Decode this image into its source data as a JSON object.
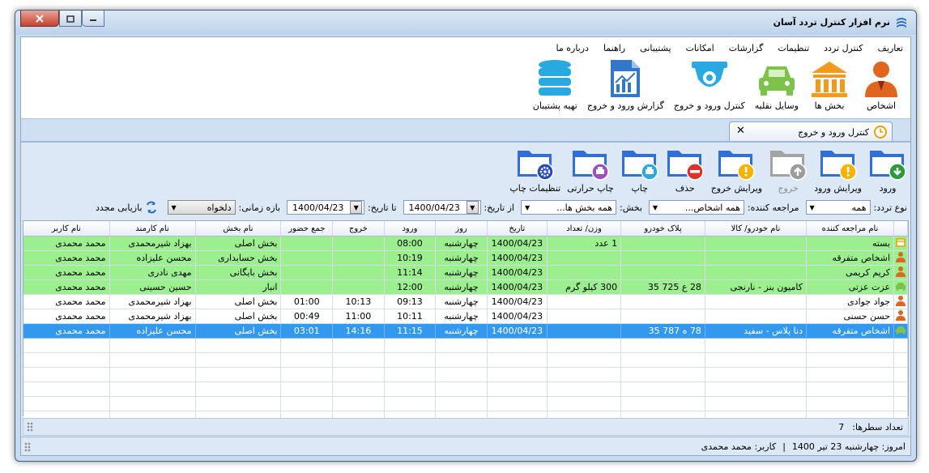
{
  "window": {
    "title": "نرم افزار کنترل تردد آسان"
  },
  "menu": [
    "تعاریف",
    "کنترل تردد",
    "تنظیمات",
    "گزارشات",
    "امکانات",
    "پشتیبانی",
    "راهنما",
    "درباره ما"
  ],
  "ribbon": [
    {
      "label": "اشخاص",
      "icon": "person-icon",
      "color": "#e0651f"
    },
    {
      "label": "بخش ها",
      "icon": "building-icon",
      "color": "#f39a1e"
    },
    {
      "label": "وسایل نقلیه",
      "icon": "car-icon",
      "color": "#7dc24a"
    },
    {
      "label": "کنترل ورود و خروج",
      "icon": "camera-icon",
      "color": "#2aa9e0"
    },
    {
      "label": "گزارش ورود و خروج",
      "icon": "report-icon",
      "color": "#3277c8"
    },
    {
      "label": "تهیه پشتیبان",
      "icon": "database-icon",
      "color": "#2aa9e0"
    }
  ],
  "tab": {
    "label": "کنترل ورود و خروج"
  },
  "toolbar": [
    {
      "label": "ورود",
      "badge": "arrow-down-icon",
      "badge_color": "#2e9b3b",
      "enabled": true
    },
    {
      "label": "ویرایش ورود",
      "badge": "warning-icon",
      "badge_color": "#f2b400",
      "enabled": true
    },
    {
      "label": "خروج",
      "badge": "arrow-up-icon",
      "badge_color": "#9c9c9c",
      "enabled": false
    },
    {
      "label": "ویرایش خروج",
      "badge": "warning-icon",
      "badge_color": "#f2b400",
      "enabled": true
    },
    {
      "label": "حذف",
      "badge": "minus-icon",
      "badge_color": "#d8342c",
      "enabled": true
    },
    {
      "label": "چاپ",
      "badge": "printer-icon",
      "badge_color": "#2aa9e0",
      "enabled": true
    },
    {
      "label": "چاپ حرارتی",
      "badge": "printer-icon",
      "badge_color": "#9b4fc3",
      "enabled": true
    },
    {
      "label": "تنظیمات چاپ",
      "badge": "gear-icon",
      "badge_color": "#2a49b8",
      "enabled": true
    }
  ],
  "filters": {
    "traffic_type_label": "نوع تردد:",
    "traffic_type_value": "همه",
    "visitor_label": "مراجعه کننده:",
    "visitor_value": "همه اشخاص...",
    "section_label": "بخش:",
    "section_value": "همه بخش ها...",
    "from_label": "از تاریخ:",
    "from_value": "1400/04/23",
    "to_label": "تا تاریخ:",
    "to_value": "1400/04/23",
    "range_label": "بازه زمانی:",
    "range_value": "دلخواه",
    "reload_label": "بازیابی مجدد"
  },
  "table": {
    "columns": [
      "نام مراجعه کننده",
      "نام خودرو/ کالا",
      "پلاک خودرو",
      "وزن/ تعداد",
      "تاریخ",
      "روز",
      "ورود",
      "خروج",
      "جمع حضور",
      "نام بخش",
      "نام کارمند",
      "نام کاربر"
    ],
    "rows": [
      {
        "icon": "package-icon",
        "style": "green",
        "cells": [
          "بسته",
          "",
          "",
          "1 عدد",
          "1400/04/23",
          "چهارشنبه",
          "08:00",
          "",
          "",
          "بخش اصلی",
          "بهزاد شیرمحمدی",
          "محمد محمدی"
        ]
      },
      {
        "icon": "person-icon",
        "style": "green",
        "cells": [
          "اشخاص متفرقه",
          "",
          "",
          "",
          "1400/04/23",
          "چهارشنبه",
          "10:19",
          "",
          "",
          "بخش حسابداری",
          "محسن علیزاده",
          "محمد محمدی"
        ]
      },
      {
        "icon": "person-icon",
        "style": "green",
        "cells": [
          "کریم کریمی",
          "",
          "",
          "",
          "1400/04/23",
          "چهارشنبه",
          "11:14",
          "",
          "",
          "بخش بایگانی",
          "مهدی نادری",
          "محمد محمدی"
        ]
      },
      {
        "icon": "car-icon",
        "style": "green",
        "cells": [
          "عزت عزتی",
          "کامیون بنز - نارنجی",
          "28 ع 725 35",
          "300 کیلو گرم",
          "1400/04/23",
          "چهارشنبه",
          "12:00",
          "",
          "",
          "انبار",
          "حسین حسینی",
          "محمد محمدی"
        ]
      },
      {
        "icon": "person-icon",
        "style": "white",
        "cells": [
          "جواد جوادی",
          "",
          "",
          "",
          "1400/04/23",
          "چهارشنبه",
          "09:13",
          "10:13",
          "01:00",
          "بخش اصلی",
          "بهزاد شیرمحمدی",
          "محمد محمدی"
        ]
      },
      {
        "icon": "person-icon",
        "style": "white",
        "cells": [
          "حسن حسنی",
          "",
          "",
          "",
          "1400/04/23",
          "چهارشنبه",
          "10:11",
          "11:00",
          "00:49",
          "بخش اصلی",
          "بهزاد شیرمحمدی",
          "محمد محمدی"
        ]
      },
      {
        "icon": "car-icon",
        "style": "selected",
        "cells": [
          "اشخاص متفرقه",
          "دنا پلاس - سفید",
          "78 ه 787 35",
          "",
          "1400/04/23",
          "چهارشنبه",
          "11:15",
          "14:16",
          "03:01",
          "بخش اصلی",
          "محسن علیزاده",
          "محمد محمدی"
        ]
      }
    ]
  },
  "footer": {
    "row_count_label": "تعداد سطرها:",
    "row_count": "7"
  },
  "status": {
    "today": "امروز: چهارشنبه 23 تیر 1400",
    "separator": "|",
    "user": "کاربر: محمد محمدی"
  }
}
